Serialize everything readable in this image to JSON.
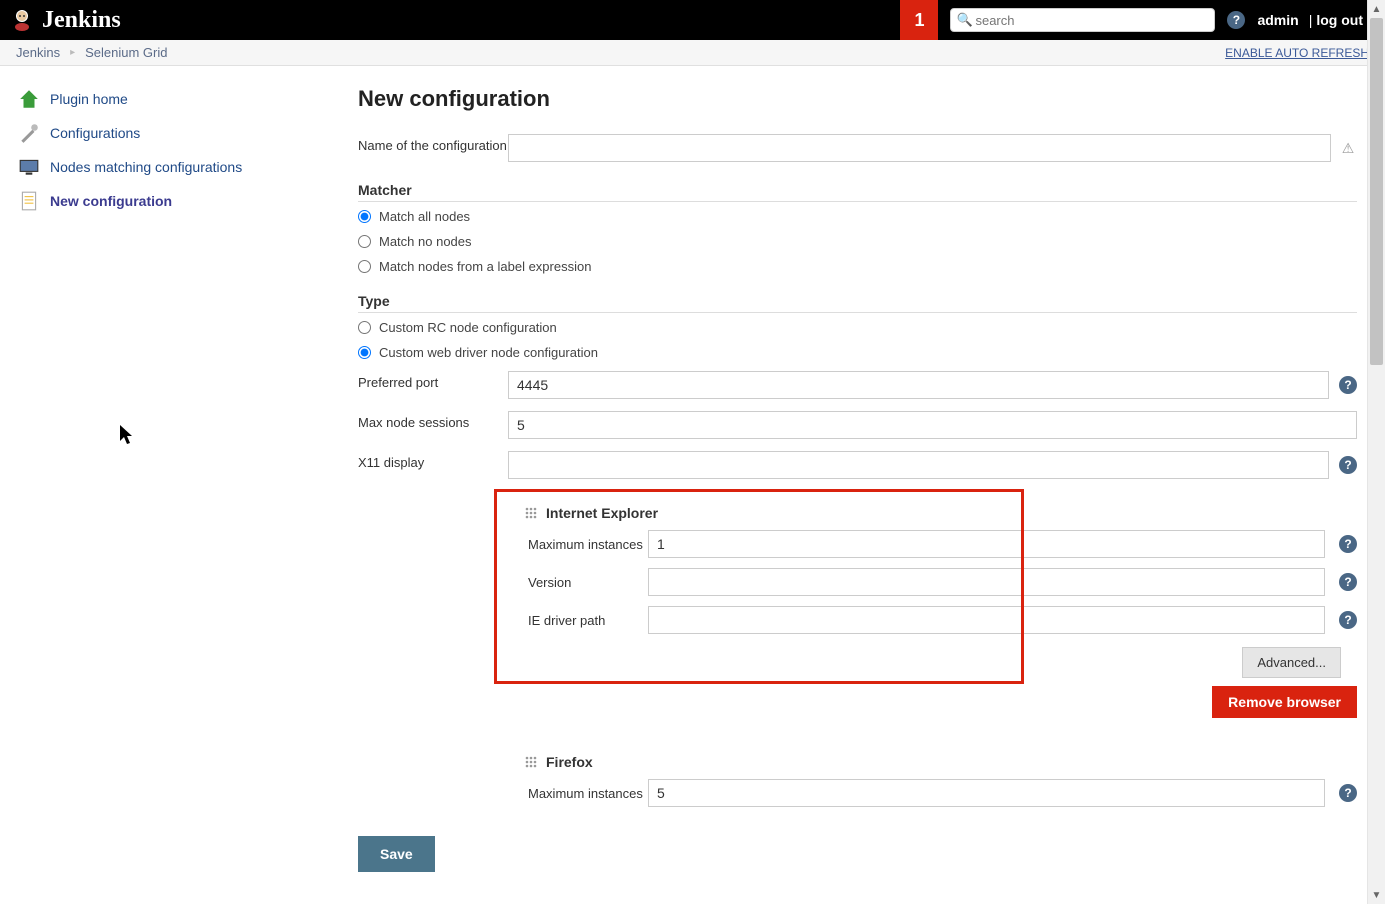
{
  "header": {
    "brand": "Jenkins",
    "notif_count": "1",
    "search_placeholder": "search",
    "user": "admin",
    "logout": "log out"
  },
  "crumbs": {
    "root": "Jenkins",
    "page": "Selenium Grid",
    "auto_refresh": "ENABLE AUTO REFRESH"
  },
  "sidebar": {
    "items": [
      {
        "label": "Plugin home"
      },
      {
        "label": "Configurations"
      },
      {
        "label": "Nodes matching configurations"
      },
      {
        "label": "New configuration"
      }
    ]
  },
  "form": {
    "title": "New configuration",
    "name_label": "Name of the configuration",
    "name_value": "",
    "matcher_label": "Matcher",
    "matcher_options": [
      "Match all nodes",
      "Match no nodes",
      "Match nodes from a label expression"
    ],
    "type_label": "Type",
    "type_options": [
      "Custom RC node configuration",
      "Custom web driver node configuration"
    ],
    "port_label": "Preferred port",
    "port_value": "4445",
    "max_sessions_label": "Max node sessions",
    "max_sessions_value": "5",
    "x11_label": "X11 display",
    "x11_value": "",
    "browsers": [
      {
        "name": "Internet Explorer",
        "max_label": "Maximum instances",
        "max_value": "1",
        "version_label": "Version",
        "version_value": "",
        "driver_label": "IE driver path",
        "driver_value": "",
        "advanced_label": "Advanced...",
        "remove_label": "Remove browser"
      },
      {
        "name": "Firefox",
        "max_label": "Maximum instances",
        "max_value": "5"
      }
    ],
    "save_label": "Save"
  }
}
